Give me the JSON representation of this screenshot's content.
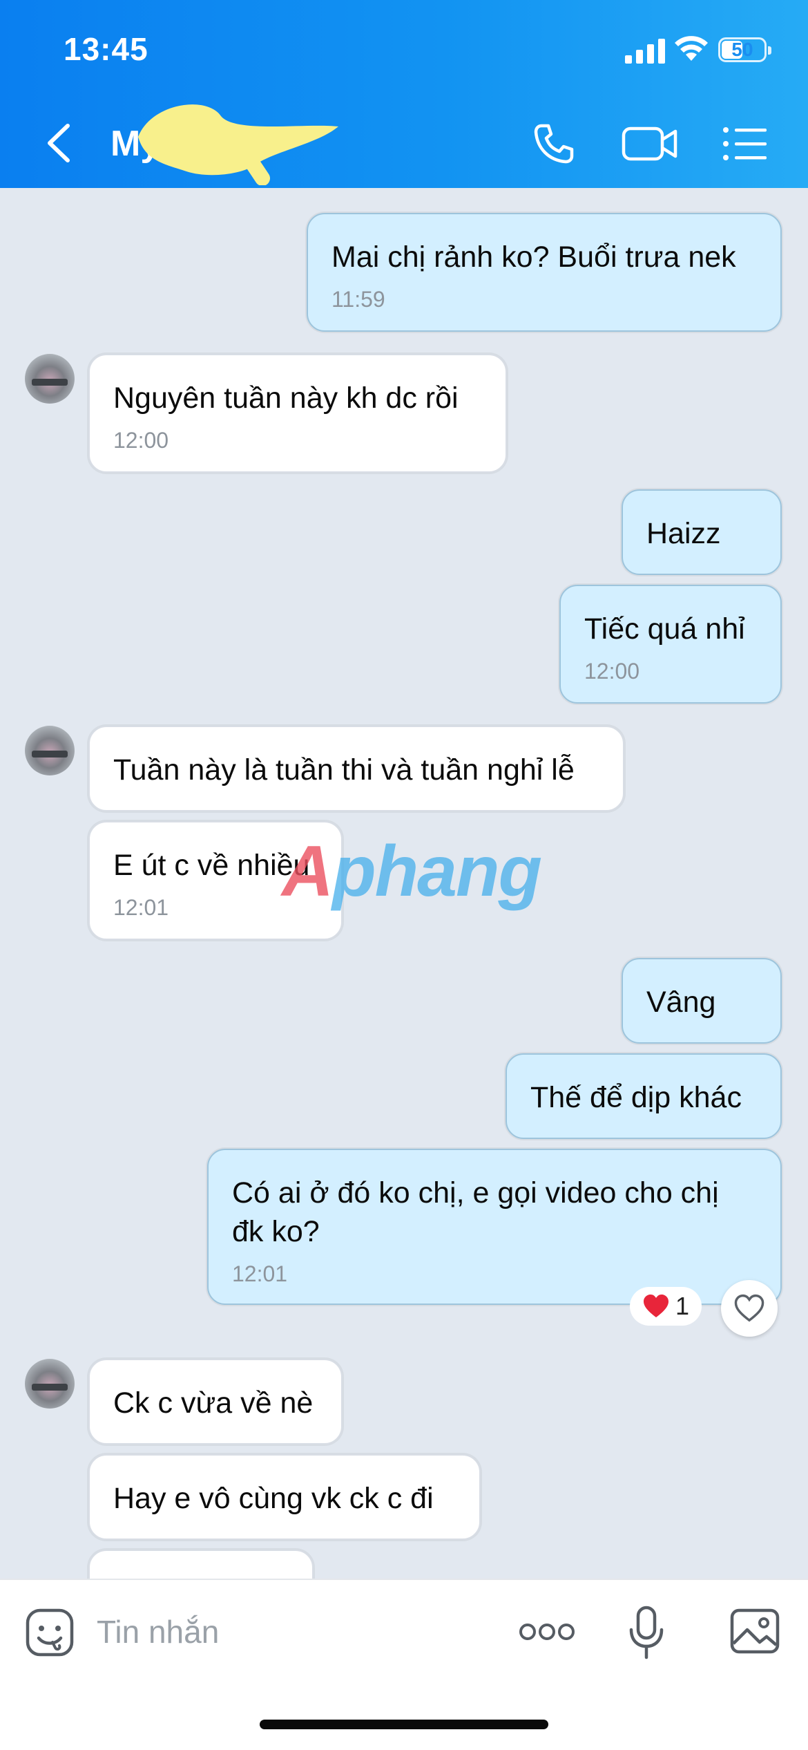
{
  "status_bar": {
    "time": "13:45",
    "battery": "50"
  },
  "header": {
    "contact_name": "My"
  },
  "messages": [
    {
      "side": "out",
      "text": "Mai chị rảnh ko? Buổi trưa nek",
      "time": "11:59"
    },
    {
      "side": "in",
      "text": "Nguyên tuần này kh dc rồi",
      "time": "12:00"
    },
    {
      "side": "out",
      "text": "Haizz",
      "time": ""
    },
    {
      "side": "out",
      "text": "Tiếc quá nhỉ",
      "time": "12:00"
    },
    {
      "side": "in",
      "text": "Tuần này là tuần thi và tuần nghỉ lễ",
      "time": ""
    },
    {
      "side": "in",
      "text": "E út c về nhiều",
      "time": "12:01"
    },
    {
      "side": "out",
      "text": "Vâng",
      "time": ""
    },
    {
      "side": "out",
      "text": "Thế để dịp khác",
      "time": ""
    },
    {
      "side": "out",
      "text": "Có ai ở đó ko chị, e gọi video cho chị đk ko?",
      "time": "12:01",
      "reaction": {
        "emoji": "heart",
        "count": "1"
      }
    },
    {
      "side": "in",
      "text": "Ck c vừa về nè",
      "time": ""
    },
    {
      "side": "in",
      "text": "Hay e vô cùng vk ck c đi",
      "time": ""
    }
  ],
  "reaction": {
    "count": "1"
  },
  "watermark": {
    "first": "A",
    "rest": "phang"
  },
  "composer": {
    "placeholder": "Tin nhắn"
  },
  "colors": {
    "header_gradient_start": "#0a7ff0",
    "header_gradient_end": "#26abf5",
    "outgoing_bubble": "#d3efff",
    "incoming_bubble": "#ffffff",
    "chat_background": "#e2e8f0"
  },
  "icons": [
    "back-icon",
    "phone-icon",
    "video-call-icon",
    "list-menu-icon",
    "heart-icon",
    "emoji-icon",
    "more-dots-icon",
    "microphone-icon",
    "image-icon"
  ]
}
